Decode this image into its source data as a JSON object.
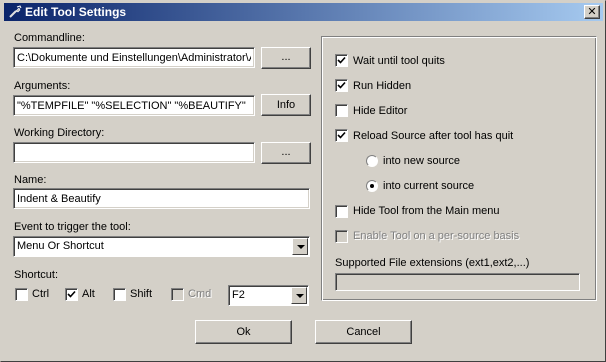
{
  "window": {
    "title": "Edit Tool Settings",
    "close_glyph": "✕"
  },
  "commandline": {
    "label": "Commandline:",
    "value": "C:\\Dokumente und Einstellungen\\Administrator\\A",
    "browse_label": "..."
  },
  "arguments": {
    "label": "Arguments:",
    "value": "\"%TEMPFILE\" \"%SELECTION\" \"%BEAUTIFY\"",
    "info_label": "Info"
  },
  "working_directory": {
    "label": "Working Directory:",
    "value": "",
    "browse_label": "..."
  },
  "name": {
    "label": "Name:",
    "value": "Indent & Beautify"
  },
  "event": {
    "label": "Event to trigger the tool:",
    "selected": "Menu Or Shortcut"
  },
  "shortcut": {
    "label": "Shortcut:",
    "ctrl": {
      "label": "Ctrl",
      "checked": false
    },
    "alt": {
      "label": "Alt",
      "checked": true
    },
    "shift": {
      "label": "Shift",
      "checked": false
    },
    "cmd": {
      "label": "Cmd",
      "checked": false,
      "disabled": true
    },
    "key": "F2"
  },
  "options": {
    "wait_until_quits": {
      "label": "Wait until tool quits",
      "checked": true
    },
    "run_hidden": {
      "label": "Run Hidden",
      "checked": true
    },
    "hide_editor": {
      "label": "Hide Editor",
      "checked": false
    },
    "reload_source": {
      "label": "Reload Source after tool has quit",
      "checked": true
    },
    "into_new_source": {
      "label": "into new source",
      "selected": false
    },
    "into_current_source": {
      "label": "into current source",
      "selected": true
    },
    "hide_from_main_menu": {
      "label": "Hide Tool from the Main menu",
      "checked": false
    },
    "per_source": {
      "label": "Enable Tool on a per-source basis",
      "checked": false,
      "disabled": true
    }
  },
  "extensions": {
    "label": "Supported File extensions (ext1,ext2,...)",
    "value": ""
  },
  "buttons": {
    "ok": "Ok",
    "cancel": "Cancel"
  },
  "icons": {
    "title": "tool-icon",
    "close": "close-icon",
    "check": "checkmark-icon",
    "dropdown": "chevron-down-icon"
  }
}
